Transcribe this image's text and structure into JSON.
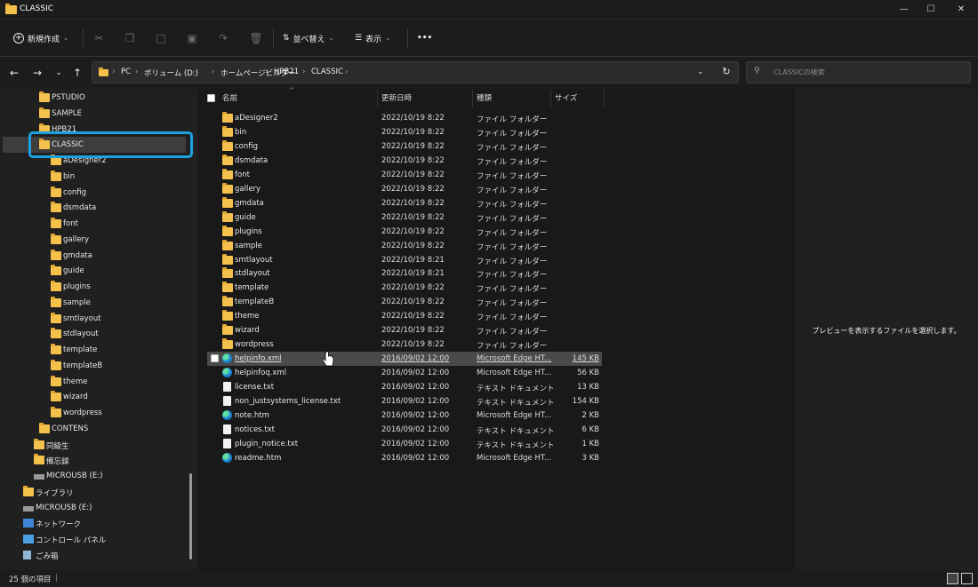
{
  "window": {
    "title": "CLASSIC",
    "minimize_icon": "minimize-icon",
    "maximize_icon": "maximize-icon",
    "close_icon": "close-icon"
  },
  "toolbar": {
    "new_label": "新規作成",
    "sort_label": "並べ替え",
    "view_label": "表示",
    "more_label": "•••"
  },
  "breadcrumb": [
    "PC",
    "ボリューム (D:)",
    "ホームページビルダー",
    "HPB21",
    "CLASSIC"
  ],
  "search": {
    "placeholder": "CLASSICの検索"
  },
  "nav": [
    {
      "label": "PSTUDIO",
      "indent": 2,
      "icon": "folder"
    },
    {
      "label": "SAMPLE",
      "indent": 2,
      "icon": "folder"
    },
    {
      "label": "HPB21",
      "indent": 2,
      "icon": "folder"
    },
    {
      "label": "CLASSIC",
      "indent": 2,
      "icon": "folder"
    },
    {
      "label": "aDesigner2",
      "indent": 3,
      "icon": "folder"
    },
    {
      "label": "bin",
      "indent": 3,
      "icon": "folder"
    },
    {
      "label": "config",
      "indent": 3,
      "icon": "folder"
    },
    {
      "label": "dsmdata",
      "indent": 3,
      "icon": "folder"
    },
    {
      "label": "font",
      "indent": 3,
      "icon": "folder"
    },
    {
      "label": "gallery",
      "indent": 3,
      "icon": "folder"
    },
    {
      "label": "gmdata",
      "indent": 3,
      "icon": "folder"
    },
    {
      "label": "guide",
      "indent": 3,
      "icon": "folder"
    },
    {
      "label": "plugins",
      "indent": 3,
      "icon": "folder"
    },
    {
      "label": "sample",
      "indent": 3,
      "icon": "folder"
    },
    {
      "label": "smtlayout",
      "indent": 3,
      "icon": "folder"
    },
    {
      "label": "stdlayout",
      "indent": 3,
      "icon": "folder"
    },
    {
      "label": "template",
      "indent": 3,
      "icon": "folder"
    },
    {
      "label": "templateB",
      "indent": 3,
      "icon": "folder"
    },
    {
      "label": "theme",
      "indent": 3,
      "icon": "folder"
    },
    {
      "label": "wizard",
      "indent": 3,
      "icon": "folder"
    },
    {
      "label": "wordpress",
      "indent": 3,
      "icon": "folder"
    },
    {
      "label": "CONTENS",
      "indent": 2,
      "icon": "folder"
    },
    {
      "label": "同級生",
      "indent": 1,
      "icon": "folder"
    },
    {
      "label": "備忘録",
      "indent": 1,
      "icon": "folder"
    },
    {
      "label": "MICROUSB (E:)",
      "indent": 1,
      "icon": "drive"
    },
    {
      "label": "ライブラリ",
      "indent": 0,
      "icon": "folder"
    },
    {
      "label": "MICROUSB (E:)",
      "indent": 0,
      "icon": "drive"
    },
    {
      "label": "ネットワーク",
      "indent": 0,
      "icon": "network"
    },
    {
      "label": "コントロール パネル",
      "indent": 0,
      "icon": "control"
    },
    {
      "label": "ごみ箱",
      "indent": 0,
      "icon": "trash"
    }
  ],
  "columns": {
    "name": "名前",
    "date": "更新日時",
    "type": "種類",
    "size": "サイズ"
  },
  "files": [
    {
      "name": "aDesigner2",
      "date": "2022/10/19 8:22",
      "type": "ファイル フォルダー",
      "size": "",
      "icon": "folder"
    },
    {
      "name": "bin",
      "date": "2022/10/19 8:22",
      "type": "ファイル フォルダー",
      "size": "",
      "icon": "folder"
    },
    {
      "name": "config",
      "date": "2022/10/19 8:22",
      "type": "ファイル フォルダー",
      "size": "",
      "icon": "folder"
    },
    {
      "name": "dsmdata",
      "date": "2022/10/19 8:22",
      "type": "ファイル フォルダー",
      "size": "",
      "icon": "folder"
    },
    {
      "name": "font",
      "date": "2022/10/19 8:22",
      "type": "ファイル フォルダー",
      "size": "",
      "icon": "folder"
    },
    {
      "name": "gallery",
      "date": "2022/10/19 8:22",
      "type": "ファイル フォルダー",
      "size": "",
      "icon": "folder"
    },
    {
      "name": "gmdata",
      "date": "2022/10/19 8:22",
      "type": "ファイル フォルダー",
      "size": "",
      "icon": "folder"
    },
    {
      "name": "guide",
      "date": "2022/10/19 8:22",
      "type": "ファイル フォルダー",
      "size": "",
      "icon": "folder"
    },
    {
      "name": "plugins",
      "date": "2022/10/19 8:22",
      "type": "ファイル フォルダー",
      "size": "",
      "icon": "folder"
    },
    {
      "name": "sample",
      "date": "2022/10/19 8:22",
      "type": "ファイル フォルダー",
      "size": "",
      "icon": "folder"
    },
    {
      "name": "smtlayout",
      "date": "2022/10/19 8:21",
      "type": "ファイル フォルダー",
      "size": "",
      "icon": "folder"
    },
    {
      "name": "stdlayout",
      "date": "2022/10/19 8:21",
      "type": "ファイル フォルダー",
      "size": "",
      "icon": "folder"
    },
    {
      "name": "template",
      "date": "2022/10/19 8:22",
      "type": "ファイル フォルダー",
      "size": "",
      "icon": "folder"
    },
    {
      "name": "templateB",
      "date": "2022/10/19 8:22",
      "type": "ファイル フォルダー",
      "size": "",
      "icon": "folder"
    },
    {
      "name": "theme",
      "date": "2022/10/19 8:22",
      "type": "ファイル フォルダー",
      "size": "",
      "icon": "folder"
    },
    {
      "name": "wizard",
      "date": "2022/10/19 8:22",
      "type": "ファイル フォルダー",
      "size": "",
      "icon": "folder"
    },
    {
      "name": "wordpress",
      "date": "2022/10/19 8:22",
      "type": "ファイル フォルダー",
      "size": "",
      "icon": "folder"
    },
    {
      "name": "helpinfo.xml",
      "date": "2016/09/02 12:00",
      "type": "Microsoft Edge HT...",
      "size": "145 KB",
      "icon": "edge",
      "selected": true
    },
    {
      "name": "helpinfoq.xml",
      "date": "2016/09/02 12:00",
      "type": "Microsoft Edge HT...",
      "size": "56 KB",
      "icon": "edge"
    },
    {
      "name": "license.txt",
      "date": "2016/09/02 12:00",
      "type": "テキスト ドキュメント",
      "size": "13 KB",
      "icon": "text"
    },
    {
      "name": "non_justsystems_license.txt",
      "date": "2016/09/02 12:00",
      "type": "テキスト ドキュメント",
      "size": "154 KB",
      "icon": "text"
    },
    {
      "name": "note.htm",
      "date": "2016/09/02 12:00",
      "type": "Microsoft Edge HT...",
      "size": "2 KB",
      "icon": "edge"
    },
    {
      "name": "notices.txt",
      "date": "2016/09/02 12:00",
      "type": "テキスト ドキュメント",
      "size": "6 KB",
      "icon": "text"
    },
    {
      "name": "plugin_notice.txt",
      "date": "2016/09/02 12:00",
      "type": "テキスト ドキュメント",
      "size": "1 KB",
      "icon": "text"
    },
    {
      "name": "readme.htm",
      "date": "2016/09/02 12:00",
      "type": "Microsoft Edge HT...",
      "size": "3 KB",
      "icon": "edge"
    }
  ],
  "preview": {
    "message": "プレビューを表示するファイルを選択します。"
  },
  "status": {
    "count": "25 個の項目"
  },
  "colors": {
    "accent": "#1aa3e0",
    "folder": "#f4c14c",
    "background": "#191919"
  }
}
